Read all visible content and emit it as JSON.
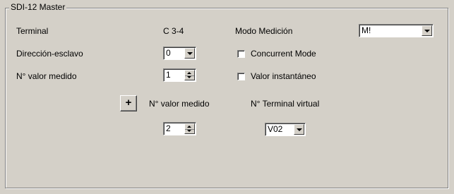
{
  "group": {
    "title": "SDI-12 Master"
  },
  "terminal": {
    "label": "Terminal",
    "value": "C 3-4"
  },
  "modo_medicion": {
    "label": "Modo Medición",
    "selected": "M!"
  },
  "direccion_esclavo": {
    "label": "Dirección-esclavo",
    "selected": "0"
  },
  "concurrent_mode": {
    "label": "Concurrent Mode",
    "checked": false
  },
  "valor_medido": {
    "label": "N° valor medido",
    "value": "1"
  },
  "valor_instantaneo": {
    "label": "Valor instantáneo",
    "checked": false
  },
  "add_row": {
    "button_label": "+",
    "col_valor_medido": "N° valor medido",
    "col_terminal_virtual": "N° Terminal virtual",
    "valor_medido_value": "2",
    "terminal_virtual_selected": "V02"
  }
}
